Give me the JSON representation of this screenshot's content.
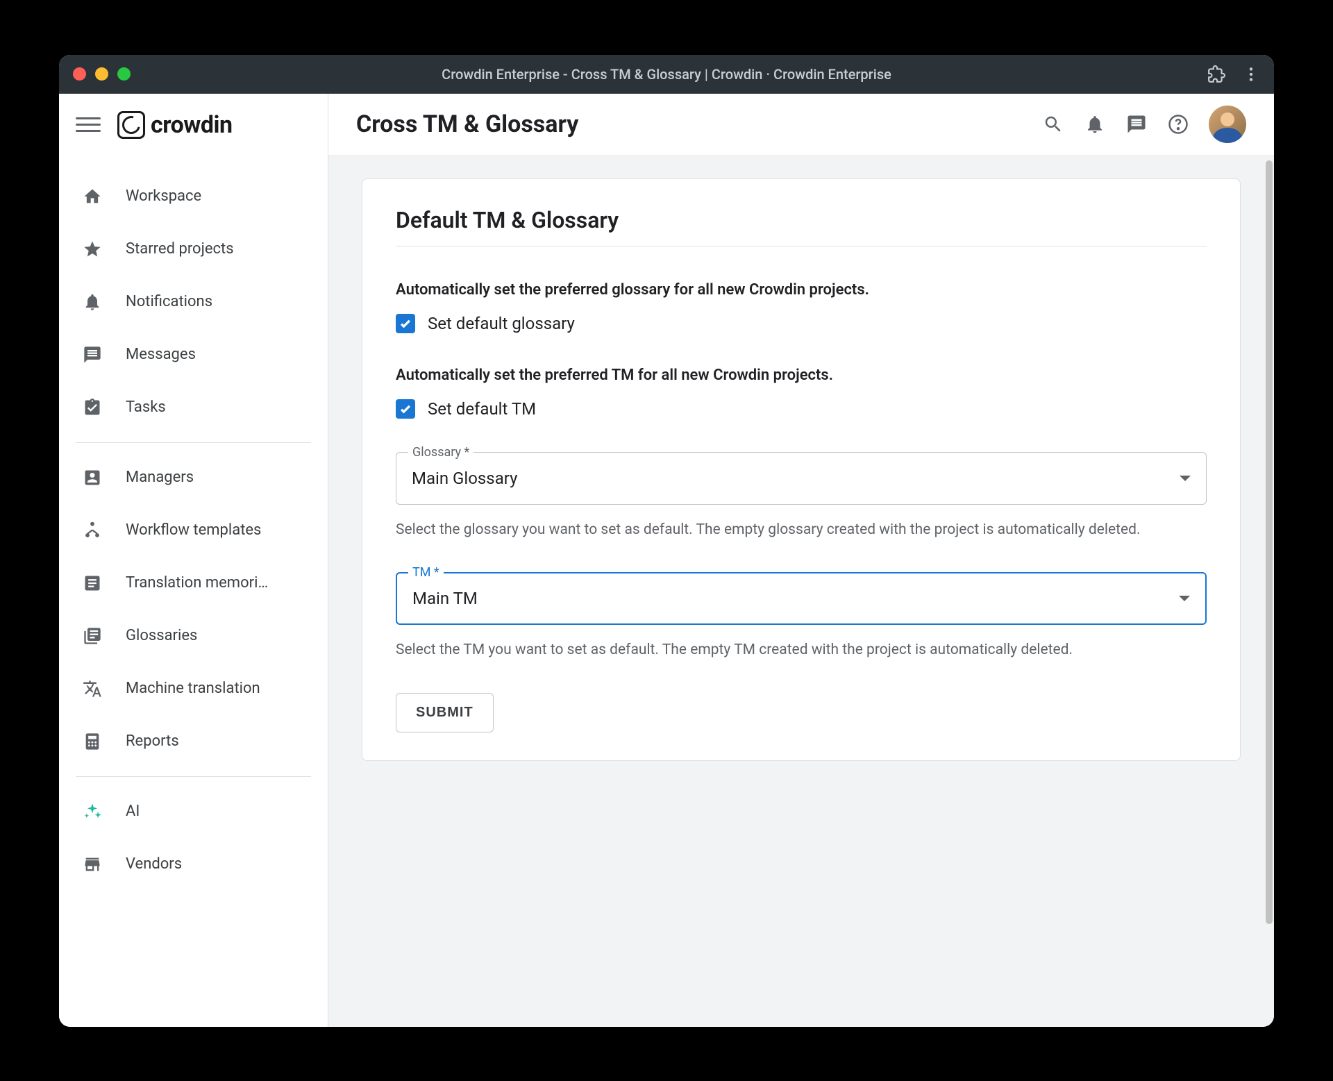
{
  "titlebar": {
    "title": "Crowdin Enterprise - Cross TM & Glossary | Crowdin · Crowdin Enterprise"
  },
  "logo": {
    "text": "crowdin"
  },
  "sidebar": {
    "items": [
      {
        "label": "Workspace"
      },
      {
        "label": "Starred projects"
      },
      {
        "label": "Notifications"
      },
      {
        "label": "Messages"
      },
      {
        "label": "Tasks"
      },
      {
        "label": "Managers"
      },
      {
        "label": "Workflow templates"
      },
      {
        "label": "Translation memori…"
      },
      {
        "label": "Glossaries"
      },
      {
        "label": "Machine translation"
      },
      {
        "label": "Reports"
      },
      {
        "label": "AI"
      },
      {
        "label": "Vendors"
      }
    ]
  },
  "header": {
    "title": "Cross TM & Glossary"
  },
  "card": {
    "title": "Default TM & Glossary",
    "glossary_desc": "Automatically set the preferred glossary for all new Crowdin projects.",
    "glossary_checkbox": "Set default glossary",
    "tm_desc": "Automatically set the preferred TM for all new Crowdin projects.",
    "tm_checkbox": "Set default TM",
    "glossary_field_label": "Glossary *",
    "glossary_field_value": "Main Glossary",
    "glossary_help": "Select the glossary you want to set as default. The empty glossary created with the project is automatically deleted.",
    "tm_field_label": "TM *",
    "tm_field_value": "Main TM",
    "tm_help": "Select the TM you want to set as default. The empty TM created with the project is automatically deleted.",
    "submit": "SUBMIT"
  }
}
